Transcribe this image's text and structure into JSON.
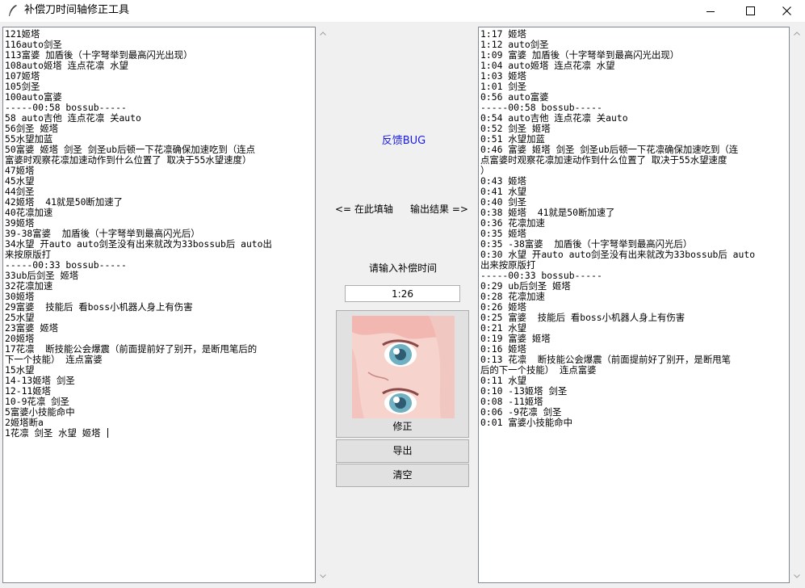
{
  "window": {
    "title": "补偿刀时间轴修正工具",
    "controls": {
      "minimize_icon": "minimize-icon",
      "maximize_icon": "maximize-icon",
      "close_icon": "close-icon"
    }
  },
  "left_textarea": {
    "lines": [
      "121姬塔",
      "116auto剑圣",
      "113富婆 加盾後（十字弩举到最高闪光出现）",
      "108auto姬塔 连点花凛 水望",
      "107姬塔",
      "105剑圣",
      "100auto富婆",
      "-----00:58 bossub-----",
      "58 auto吉他 连点花凛 关auto",
      "56剑圣 姬塔",
      "55水望加蓝",
      "50富婆 姬塔 剑圣 剑圣ub后顿一下花凛确保加速吃到（连点",
      "富婆时观察花凛加速动作到什么位置了 取决于55水望速度）",
      "47姬塔",
      "45水望",
      "44剑圣",
      "42姬塔  41就是50断加速了",
      "40花凛加速",
      "39姬塔",
      "39-38富婆  加盾後（十字弩举到最高闪光后）",
      "34水望 开auto auto剑圣没有出来就改为33bossub后 auto出",
      "来按原版打",
      "-----00:33 bossub-----",
      "33ub后剑圣 姬塔",
      "32花凛加速",
      "30姬塔",
      "29富婆  技能后 看boss小机器人身上有伤害",
      "25水望",
      "23富婆 姬塔",
      "20姬塔",
      "17花凛  断技能公会爆震（前面提前好了别开，是断甩笔后的",
      "下一个技能） 连点富婆",
      "15水望",
      "14-13姬塔 剑圣",
      "12-11姬塔",
      "10-9花凛 剑圣",
      "5富婆小技能命中",
      "2姬塔断a",
      "1花凛 剑圣 水望 姬塔 "
    ]
  },
  "right_textarea": {
    "lines": [
      "1:17 姬塔",
      "1:12 auto剑圣",
      "1:09 富婆 加盾後（十字弩举到最高闪光出现）",
      "1:04 auto姬塔 连点花凛 水望",
      "1:03 姬塔",
      "1:01 剑圣",
      "0:56 auto富婆",
      "-----00:58 bossub-----",
      "0:54 auto吉他 连点花凛 关auto",
      "0:52 剑圣 姬塔",
      "0:51 水望加蓝",
      "0:46 富婆 姬塔 剑圣 剑圣ub后顿一下花凛确保加速吃到（连",
      "点富婆时观察花凛加速动作到什么位置了 取决于55水望速度",
      "）",
      "0:43 姬塔",
      "0:41 水望",
      "0:40 剑圣",
      "0:38 姬塔  41就是50断加速了",
      "0:36 花凛加速",
      "0:35 姬塔",
      "0:35 -38富婆  加盾後（十字弩举到最高闪光后）",
      "0:30 水望 开auto auto剑圣没有出来就改为33bossub后 auto",
      "出来按原版打",
      "-----00:33 bossub-----",
      "0:29 ub后剑圣 姬塔",
      "0:28 花凛加速",
      "0:26 姬塔",
      "0:25 富婆  技能后 看boss小机器人身上有伤害",
      "0:21 水望",
      "0:19 富婆 姬塔",
      "0:16 姬塔",
      "0:13 花凛  断技能公会爆震（前面提前好了别开，是断甩笔",
      "后的下一个技能） 连点富婆",
      "0:11 水望",
      "0:10 -13姬塔 剑圣",
      "0:08 -11姬塔",
      "0:06 -9花凛 剑圣",
      "0:01 富婆小技能命中"
    ]
  },
  "middle": {
    "feedback_link": "反馈BUG",
    "fill_hint": "<= 在此填轴",
    "output_hint": "输出结果 =>",
    "time_prompt": "请输入补偿时间",
    "time_value": "1:26",
    "fix_button": "修正",
    "export_button": "导出",
    "clear_button": "清空"
  },
  "colors": {
    "link": "#1a1ae6",
    "button_bg": "#e1e1e1",
    "window_bg": "#f0f0f0"
  }
}
